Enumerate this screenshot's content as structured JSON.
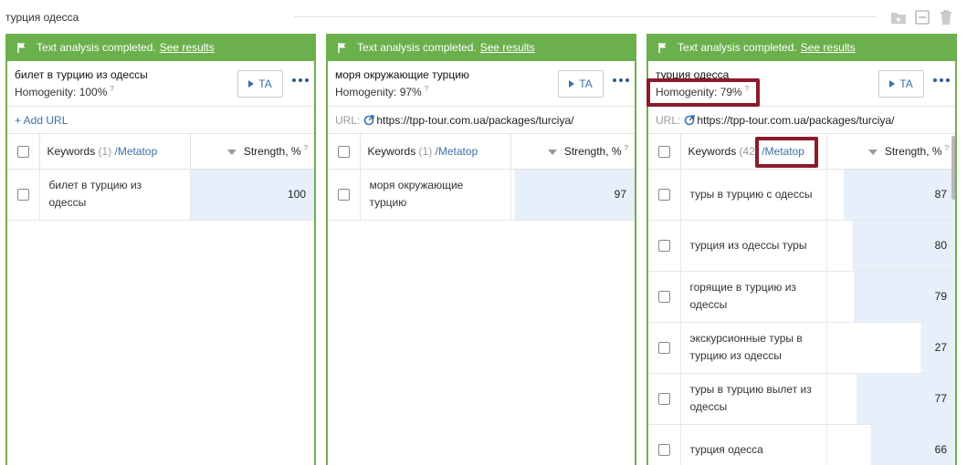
{
  "group": {
    "title": "турция одесса"
  },
  "top_icons": [
    "folder-add-icon",
    "collapse-icon",
    "trash-icon"
  ],
  "cards": [
    {
      "status_text": "Text analysis completed.",
      "status_link": "See results",
      "query": "билет в турцию из одессы",
      "homogenity": "Homogenity: 100%",
      "ta_label": "TA",
      "url_label": "",
      "url": "",
      "add_url": "+ Add URL",
      "kw_label": "Keywords",
      "kw_count": "(1)",
      "meta_label": "/Metatop",
      "strength_label": "Strength, %",
      "rows": [
        {
          "keyword": "билет в турцию из одессы",
          "strength": 100
        }
      ]
    },
    {
      "status_text": "Text analysis completed.",
      "status_link": "See results",
      "query": "моря окружающие турцию",
      "homogenity": "Homogenity: 97%",
      "ta_label": "TA",
      "url_label": "URL:",
      "url": "https://tpp-tour.com.ua/packages/turciya/",
      "add_url": "",
      "kw_label": "Keywords",
      "kw_count": "(1)",
      "meta_label": "/Metatop",
      "strength_label": "Strength, %",
      "rows": [
        {
          "keyword": "моря окружающие турцию",
          "strength": 97
        }
      ]
    },
    {
      "status_text": "Text analysis completed.",
      "status_link": "See results",
      "query": "турция одесса",
      "homogenity": "Homogenity: 79%",
      "ta_label": "TA",
      "url_label": "URL:",
      "url": "https://tpp-tour.com.ua/packages/turciya/",
      "add_url": "",
      "kw_label": "Keywords",
      "kw_count": "(42)",
      "meta_label": "/Metatop",
      "strength_label": "Strength, %",
      "rows": [
        {
          "keyword": "туры в турцию с одессы",
          "strength": 87
        },
        {
          "keyword": "турция из одессы туры",
          "strength": 80
        },
        {
          "keyword": "горящие в турцию из одессы",
          "strength": 79
        },
        {
          "keyword": "экскурсионные туры в турцию из одессы",
          "strength": 27
        },
        {
          "keyword": "туры в турцию вылет из одессы",
          "strength": 77
        },
        {
          "keyword": "турция одесса",
          "strength": 66
        }
      ]
    }
  ],
  "colors": {
    "accent_green": "#6bb04c",
    "link_blue": "#3a6fa8",
    "highlight": "#8b1a2b",
    "bar_fill": "#e6effa"
  }
}
